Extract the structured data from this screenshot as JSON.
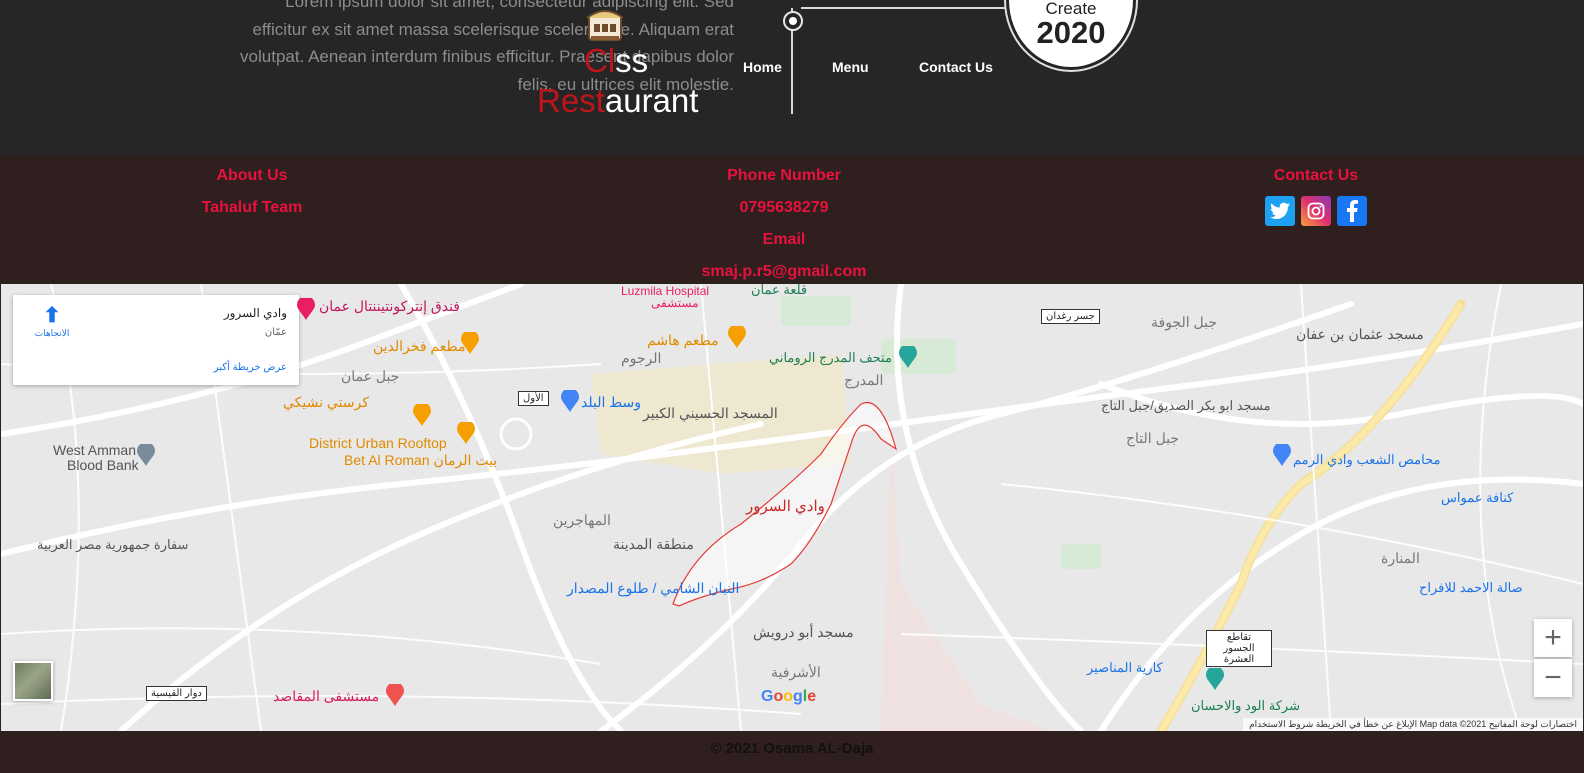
{
  "hero": {
    "lorem_lines": [
      "Lorem ipsum dolor sit amet, consectetur adipiscing elit. Sed",
      "efficitur ex sit amet massa scelerisque scelerisque. Aliquam erat",
      "volutpat. Aenean interdum finibus efficitur. Praesent dapibus dolor",
      "felis, eu ultrices elit molestie."
    ],
    "logo_line1_red": "Cl",
    "logo_line1_white": "ss",
    "logo_line2_red": "Rest",
    "logo_line2_white": "aurant",
    "badge_small": "Create",
    "badge_year": "2020"
  },
  "nav": {
    "home": "Home",
    "menu": "Menu",
    "contact": "Contact Us"
  },
  "footer": {
    "about_title": "About Us",
    "about_text": "Tahaluf Team",
    "phone_title": "Phone Number",
    "phone_value": "0795638279",
    "email_title": "Email",
    "email_value": "smaj.p.r5@gmail.com",
    "contact_title": "Contact Us",
    "social_icons": [
      "twitter-icon",
      "instagram-icon",
      "facebook-icon"
    ]
  },
  "map": {
    "place_name": "وادي السرور",
    "place_sub": "عمّان",
    "directions": "الاتجاهات",
    "larger_map": "عرض خريطة أكبر",
    "labels": {
      "luzmila": "Luzmila Hospital",
      "luzmila_ar": "مستشفى",
      "amman_castle": "قلعة عمان",
      "intercontinental": "فندق إنتركونتيننتال عمان",
      "fakhreldin": "مطعم فخرالدين",
      "hashem": "مطعم هاشم",
      "roman_theatre": "متحف المدرج الروماني",
      "jabal_amman": "جبل عمان",
      "crystal_shisha": "كرستي نشيكي",
      "downtown": "وسط البلد",
      "husseini_mosque": "المسجد الحسيني الكبير",
      "district_urban": "District Urban Rooftop",
      "bet_alroman": "Bet Al Roman بيت الرمان",
      "west_amman_blood": "West Amman",
      "west_amman_blood2": "Blood Bank",
      "wadi_sroor": "وادي السرور",
      "muhajireen": "المهاجرين",
      "madina": "منطقة المدينة",
      "egypt_embassy": "سفارة جمهورية مصر العربية",
      "alshami": "النبان الشامي / طلوع المصدار",
      "abu_darwish": "مسجد أبو درويش",
      "ashrafieh": "الأشرفية",
      "maqased": "مستشفى المقاصد",
      "othman_mosque": "مسجد عثمان بن عفان",
      "jabal_jofeh": "جبل الجوفة",
      "abu_bakr": "مسجد ابو بكر الصديق/جبل التاج",
      "jabal_taj": "جبل التاج",
      "wadi_rimam": "محامص الشعب وادي الرمم",
      "kunafa": "كنافة عمواس",
      "manara": "المنارة",
      "ahmad_hall": "صالة الاحمد للافراح",
      "manaseer": "كارية المناصير",
      "wud_ihsan": "شركة الود والاحسان",
      "bridge_raghadan": "جسر رغدان",
      "first_circle": "الأول",
      "qaisiyeh": "دوار القيسية",
      "bridges_junction": "تقاطع الجسور العشرة",
      "rajoum": "الرجوم",
      "marj": "المدرج"
    },
    "google": "Google",
    "attribution": "الإبلاغ عن خطأ في الخريطة    شروط الاستخدام    Map data ©2021    اختصارات لوحة المفاتيح",
    "zoom_in": "+",
    "zoom_out": "−"
  },
  "copyright": "© 2021 Osama AL-Daja",
  "colors": {
    "accent_red": "#e8123c",
    "logo_red": "#c0141b",
    "footer_bg": "#301f1f",
    "top_bg": "#262626"
  }
}
